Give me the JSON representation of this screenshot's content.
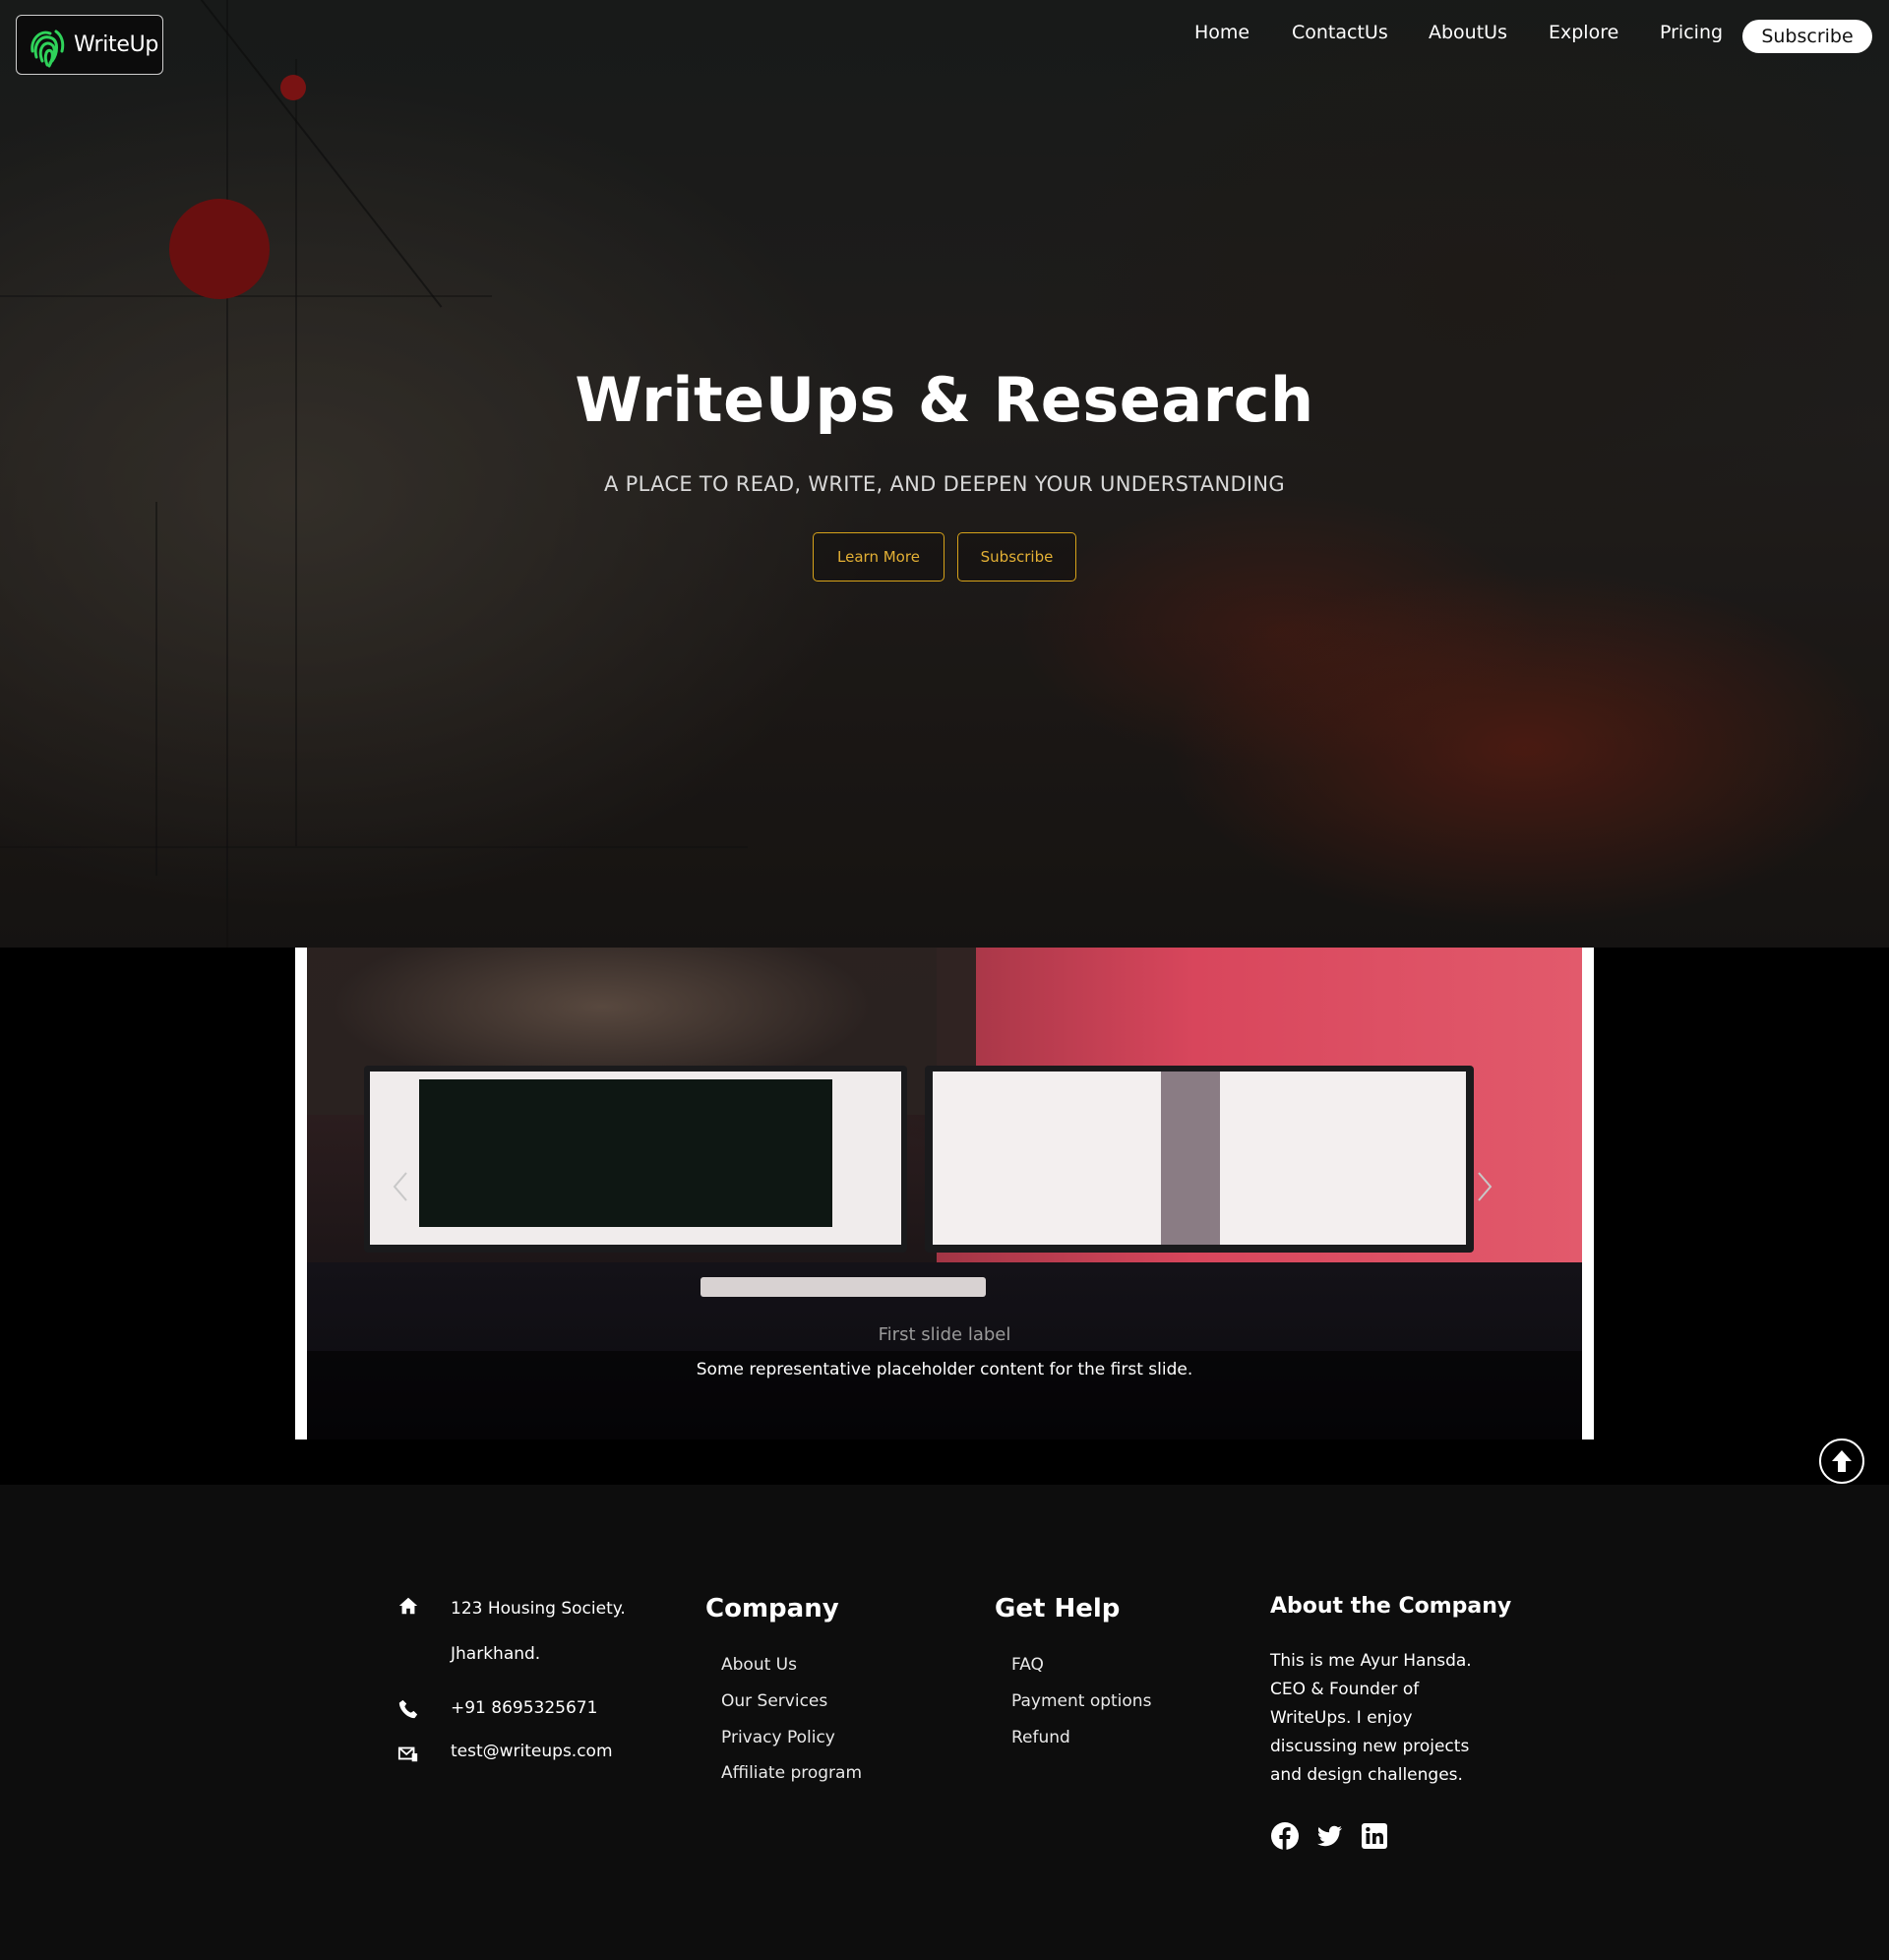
{
  "brand": {
    "name": "WriteUp",
    "accent": "#2fd35a"
  },
  "nav": {
    "items": [
      {
        "label": "Home"
      },
      {
        "label": "ContactUs"
      },
      {
        "label": "AboutUs"
      },
      {
        "label": "Explore"
      },
      {
        "label": "Pricing"
      }
    ],
    "subscribe_label": "Subscribe"
  },
  "hero": {
    "title": "WriteUps & Research",
    "subtitle": "A PLACE TO READ, WRITE, AND DEEPEN YOUR UNDERSTANDING",
    "learn_more_label": "Learn More",
    "subscribe_label": "Subscribe",
    "button_color": "#d6a21a"
  },
  "carousel": {
    "prev_icon": "chevron-left-icon",
    "next_icon": "chevron-right-icon",
    "slide_label": "First slide label",
    "slide_text": "Some representative placeholder content for the first slide."
  },
  "scroll_top": {
    "icon": "arrow-up-circle-icon"
  },
  "footer": {
    "contact": {
      "address_line1": "123 Housing Society.",
      "address_line2": "Jharkhand.",
      "phone": "+91 8695325671",
      "email": "test@writeups.com"
    },
    "company": {
      "heading": "Company",
      "links": [
        "About Us",
        "Our Services",
        "Privacy Policy",
        "Affiliate program"
      ]
    },
    "help": {
      "heading": "Get Help",
      "links": [
        "FAQ",
        "Payment options",
        "Refund"
      ]
    },
    "about": {
      "heading": "About the Company",
      "text": "This is me Ayur Hansda. CEO & Founder of WriteUps. I enjoy discussing new projects and design challenges."
    },
    "social": [
      "facebook-icon",
      "twitter-icon",
      "linkedin-icon"
    ]
  }
}
